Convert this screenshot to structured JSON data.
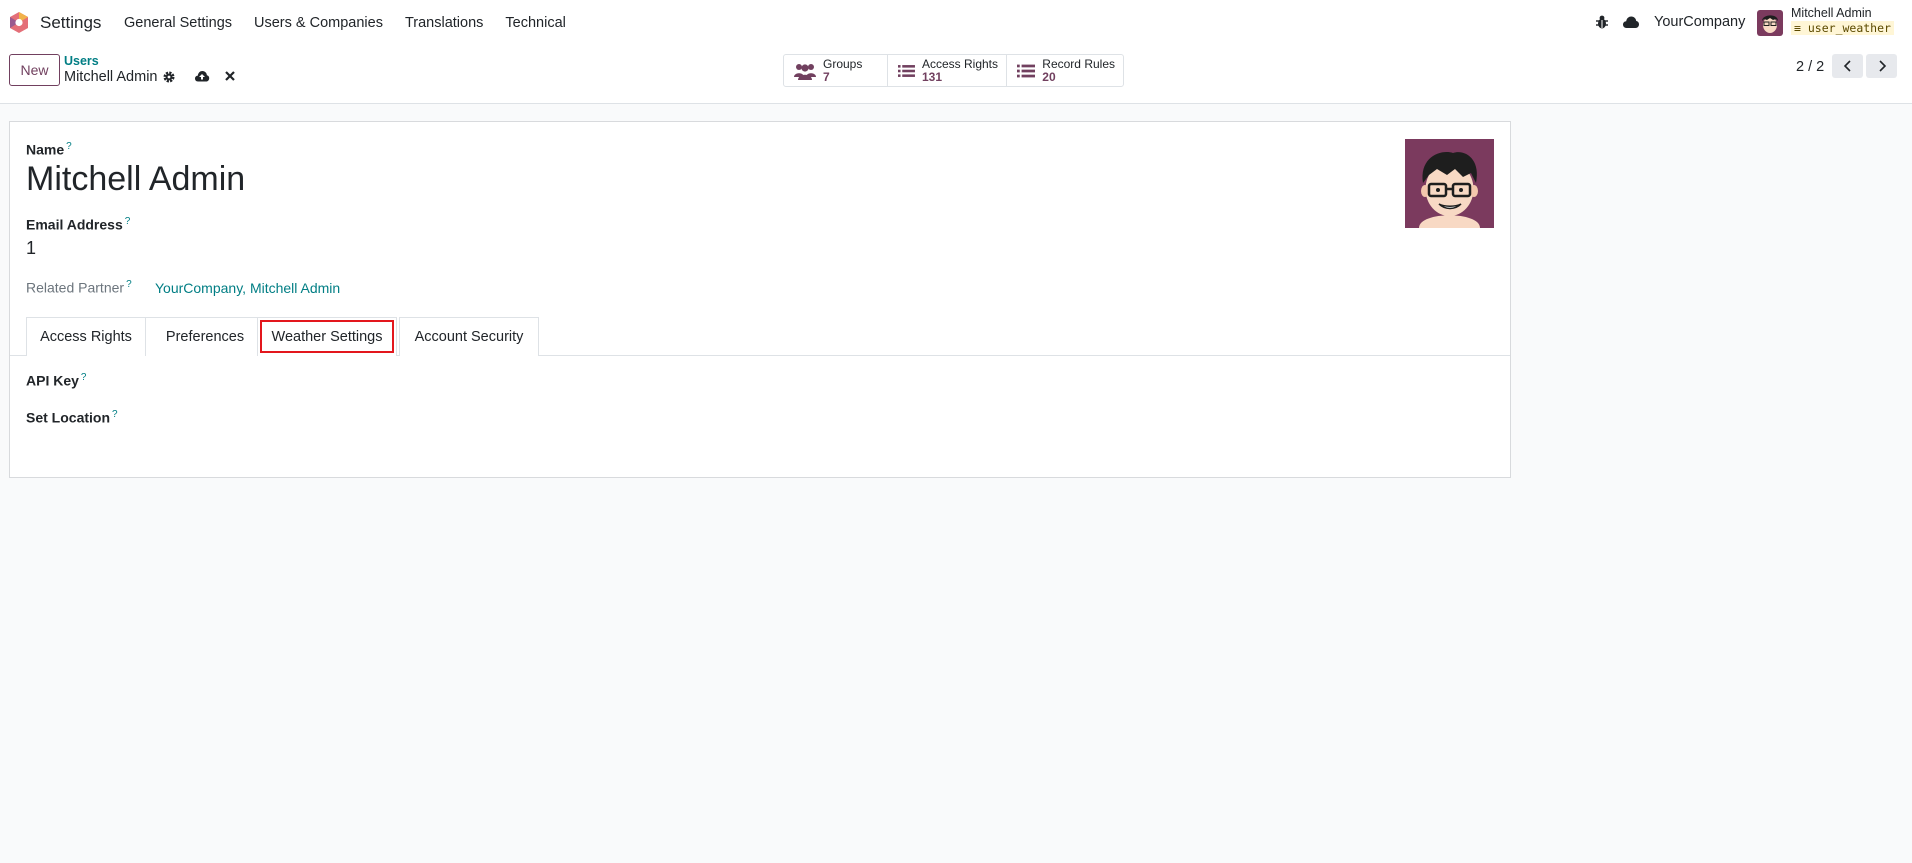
{
  "navbar": {
    "app_name": "Settings",
    "menu": [
      "General Settings",
      "Users & Companies",
      "Translations",
      "Technical"
    ],
    "company": "YourCompany",
    "user_name": "Mitchell Admin",
    "database": "user_weather"
  },
  "control_panel": {
    "new_label": "New",
    "breadcrumb_parent": "Users",
    "breadcrumb_current": "Mitchell Admin",
    "stats": [
      {
        "label": "Groups",
        "value": "7",
        "icon": "users-icon"
      },
      {
        "label": "Access Rights",
        "value": "131",
        "icon": "list-icon"
      },
      {
        "label": "Record Rules",
        "value": "20",
        "icon": "list-icon"
      }
    ],
    "pager": "2 / 2"
  },
  "form": {
    "name_label": "Name",
    "name_value": "Mitchell Admin",
    "email_label": "Email Address",
    "email_value": "1",
    "partner_label": "Related Partner",
    "partner_value": "YourCompany, Mitchell Admin",
    "help_mark": "?",
    "tabs": [
      "Access Rights",
      "Preferences",
      "Weather Settings",
      "Account Security"
    ],
    "active_tab": "Weather Settings",
    "weather_fields": [
      "API Key",
      "Set Location"
    ]
  },
  "colors": {
    "brand": "#71405f",
    "link": "#017e84",
    "highlight": "#e3171d"
  }
}
